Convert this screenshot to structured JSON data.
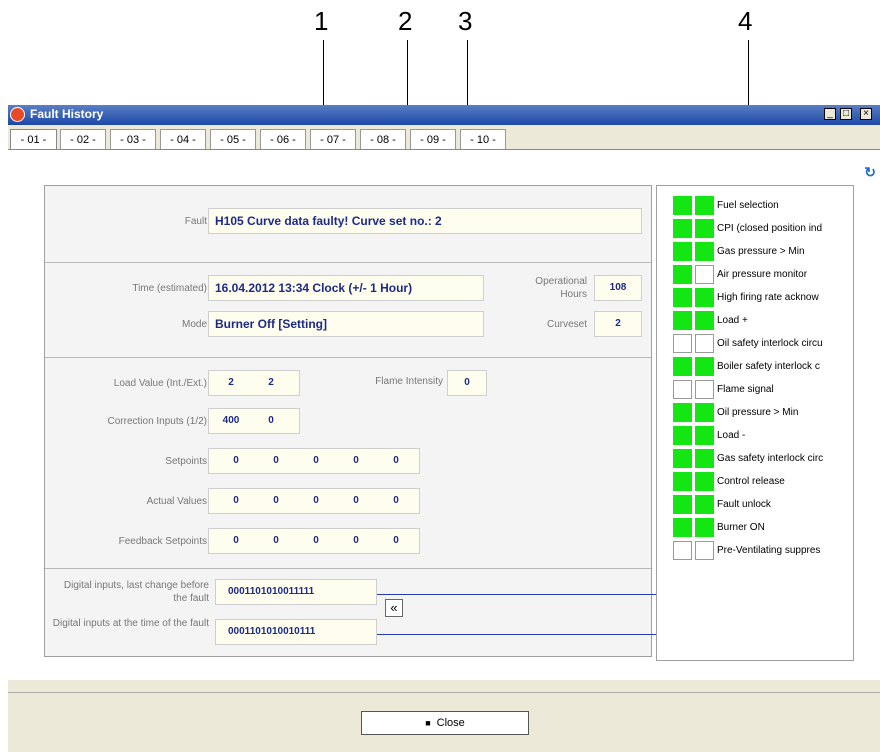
{
  "callouts": [
    "1",
    "2",
    "3",
    "4"
  ],
  "window": {
    "title": "Fault History",
    "controls": {
      "minimize": "_",
      "maximize": "□",
      "close": "×"
    },
    "tabs": [
      "- 01 -",
      "- 02 -",
      "- 03 -",
      "- 04 -",
      "- 05 -",
      "- 06 -",
      "- 07 -",
      "- 08 -",
      "- 09 -",
      "- 10 -"
    ],
    "refresh_icon": "refresh-icon"
  },
  "fault": {
    "label": "Fault",
    "value": "H105   Curve data faulty! Curve set no.:  2"
  },
  "time": {
    "label": "Time (estimated)",
    "value": "16.04.2012  13:34 Clock  (+/- 1 Hour)"
  },
  "mode": {
    "label": "Mode",
    "value": "Burner Off  [Setting]"
  },
  "operational_hours": {
    "label": "Operational Hours",
    "value": "108"
  },
  "curveset": {
    "label": "Curveset",
    "value": "2"
  },
  "load_value": {
    "label": "Load Value (Int./Ext.)",
    "values": [
      "2",
      "2"
    ]
  },
  "flame_intensity": {
    "label": "Flame Intensity",
    "value": "0"
  },
  "correction_inputs": {
    "label": "Correction Inputs (1/2)",
    "values": [
      "400",
      "0"
    ]
  },
  "setpoints": {
    "label": "Setpoints",
    "values": [
      "0",
      "0",
      "0",
      "0",
      "0"
    ]
  },
  "actual_values": {
    "label": "Actual Values",
    "values": [
      "0",
      "0",
      "0",
      "0",
      "0"
    ]
  },
  "feedback_setpoints": {
    "label": "Feedback Setpoints",
    "values": [
      "0",
      "0",
      "0",
      "0",
      "0"
    ]
  },
  "digital_last_change": {
    "label": "Digital inputs, last change before the fault",
    "value": "0001101010011111"
  },
  "digital_at_fault": {
    "label": "Digital inputs at the time of the fault",
    "value": "0001101010010111"
  },
  "expand_button": "«",
  "signals": [
    {
      "label": "Fuel selection",
      "a": true,
      "b": true
    },
    {
      "label": "CPI (closed position ind",
      "a": true,
      "b": true
    },
    {
      "label": "Gas pressure > Min",
      "a": true,
      "b": true
    },
    {
      "label": "Air pressure monitor",
      "a": true,
      "b": false
    },
    {
      "label": "High firing rate acknow",
      "a": true,
      "b": true
    },
    {
      "label": "Load +",
      "a": true,
      "b": true
    },
    {
      "label": "Oil safety interlock circu",
      "a": false,
      "b": false
    },
    {
      "label": "Boiler safety interlock c",
      "a": true,
      "b": true
    },
    {
      "label": "Flame signal",
      "a": false,
      "b": false
    },
    {
      "label": "Oil pressure > Min",
      "a": true,
      "b": true
    },
    {
      "label": "Load -",
      "a": true,
      "b": true
    },
    {
      "label": "Gas safety interlock circ",
      "a": true,
      "b": true
    },
    {
      "label": "Control release",
      "a": true,
      "b": true
    },
    {
      "label": "Fault unlock",
      "a": true,
      "b": true
    },
    {
      "label": "Burner ON",
      "a": true,
      "b": true
    },
    {
      "label": "Pre-Ventilating suppres",
      "a": false,
      "b": false
    }
  ],
  "close_button": {
    "icon": "■",
    "label": "Close"
  },
  "colors": {
    "lamp_on": "#14e614",
    "value_text": "#1a2a8a",
    "connector": "#2a3ab0"
  }
}
